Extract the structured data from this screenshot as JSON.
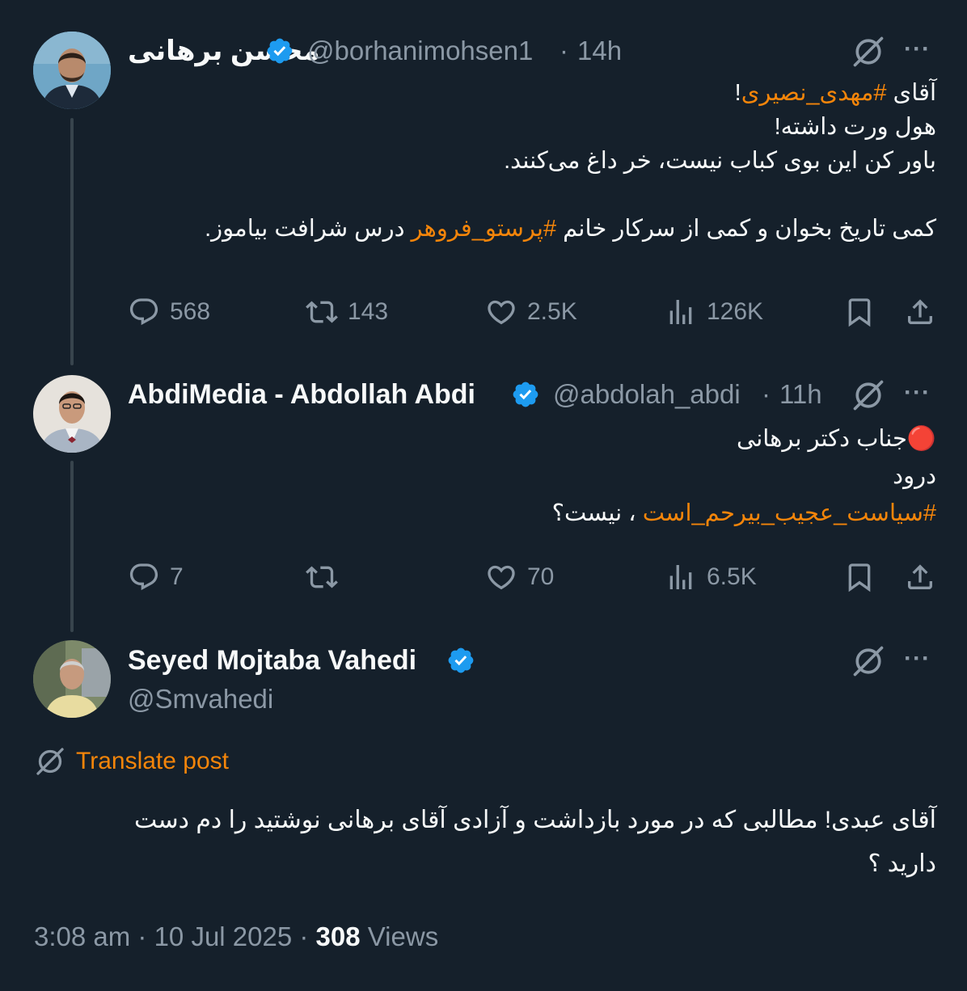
{
  "tweets": [
    {
      "name": "محسن برهانی",
      "handle": "@borhanimohsen1",
      "time": "14h",
      "body_lines": [
        [
          {
            "t": "آقای "
          },
          {
            "t": "#مهدی_نصیری",
            "h": true
          },
          {
            "t": "!"
          }
        ],
        [
          {
            "t": "هول ورت داشته!"
          }
        ],
        [
          {
            "t": "باور کن این بوی کباب نیست، خر داغ می‌کنند."
          }
        ],
        [
          {
            "t": ""
          }
        ],
        [
          {
            "t": "کمی تاریخ بخوان و کمی از سرکار خانم "
          },
          {
            "t": "#پرستو_فروهر",
            "h": true
          },
          {
            "t": " درس شرافت بیاموز."
          }
        ]
      ],
      "replies": "568",
      "retweets": "143",
      "likes": "2.5K",
      "views": "126K"
    },
    {
      "name": "AbdiMedia - Abdollah Abdi",
      "handle": "@abdolah_abdi",
      "time": "11h",
      "body_lines": [
        [
          {
            "t": "🔴جناب دکتر برهانی"
          }
        ],
        [
          {
            "t": "درود"
          }
        ],
        [
          {
            "t": "#سیاست_عجیب_بیرحم_است",
            "h": true
          },
          {
            "t": " ، نیست؟"
          }
        ]
      ],
      "replies": "7",
      "retweets": "",
      "likes": "70",
      "views": "6.5K"
    },
    {
      "name": "Seyed Mojtaba Vahedi",
      "handle": "@Smvahedi",
      "body_lines": [
        [
          {
            "t": "آقای عبدی! مطالبی  که در مورد بازداشت و آزادی آقای  برهانی  نوشتید را دم دست"
          }
        ],
        [
          {
            "t": "دارید ؟"
          }
        ]
      ]
    }
  ],
  "translate_label": "Translate post",
  "footer": {
    "time": "3:08 am · 10 Jul 2025 · ",
    "views_count": "308",
    "views_label": " Views"
  },
  "colors": {
    "background": "#15202b",
    "accent": "#f4850a",
    "verified": "#1d9bf0",
    "muted": "#8b98a5"
  },
  "icons": [
    "reply-icon",
    "retweet-icon",
    "like-icon",
    "views-icon",
    "bookmark-icon",
    "share-icon",
    "grok-icon",
    "more-icon",
    "verified-badge-icon",
    "translate-icon"
  ]
}
